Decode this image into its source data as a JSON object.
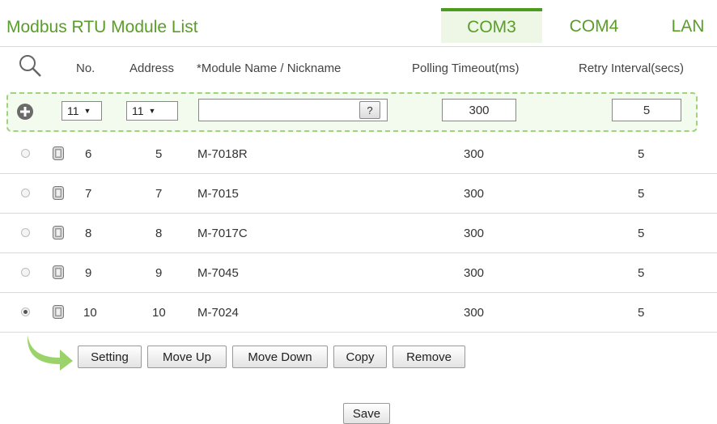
{
  "header": {
    "title": "Modbus RTU Module List",
    "tabs": [
      {
        "label": "COM3",
        "active": true
      },
      {
        "label": "COM4",
        "active": false
      },
      {
        "label": "LAN",
        "active": false
      }
    ]
  },
  "columns": {
    "no": "No.",
    "address": "Address",
    "name": "*Module Name / Nickname",
    "timeout": "Polling Timeout(ms)",
    "retry": "Retry Interval(secs)"
  },
  "add_row": {
    "no_value": "11",
    "address_value": "11",
    "name_value": "",
    "help_label": "?",
    "timeout_value": "300",
    "retry_value": "5"
  },
  "rows": [
    {
      "no": "6",
      "address": "5",
      "name": "M-7018R",
      "timeout": "300",
      "retry": "5",
      "selected": false
    },
    {
      "no": "7",
      "address": "7",
      "name": "M-7015",
      "timeout": "300",
      "retry": "5",
      "selected": false
    },
    {
      "no": "8",
      "address": "8",
      "name": "M-7017C",
      "timeout": "300",
      "retry": "5",
      "selected": false
    },
    {
      "no": "9",
      "address": "9",
      "name": "M-7045",
      "timeout": "300",
      "retry": "5",
      "selected": false
    },
    {
      "no": "10",
      "address": "10",
      "name": "M-7024",
      "timeout": "300",
      "retry": "5",
      "selected": true
    }
  ],
  "actions": {
    "setting": "Setting",
    "move_up": "Move Up",
    "move_down": "Move Down",
    "copy": "Copy",
    "remove": "Remove"
  },
  "save_label": "Save",
  "colors": {
    "accent": "#5a9d2a",
    "tab_active_bg": "#eef7e6",
    "add_row_border": "#9fd47a"
  }
}
